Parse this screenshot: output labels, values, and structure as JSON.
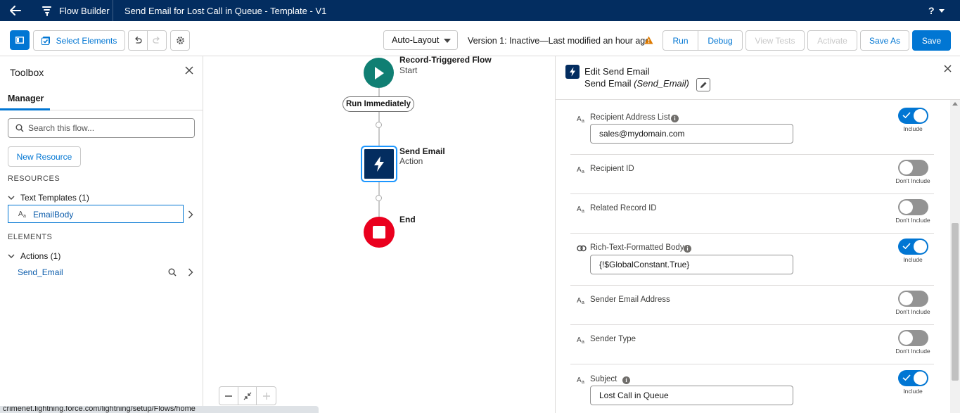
{
  "header": {
    "app_name": "Flow Builder",
    "flow_title": "Send Email for Lost Call in Queue - Template - V1",
    "help_label": "?"
  },
  "toolbar": {
    "select_elements": "Select Elements",
    "layout": "Auto-Layout",
    "version_status": "Version 1: Inactive—Last modified an hour ago",
    "run": "Run",
    "debug": "Debug",
    "view_tests": "View Tests",
    "activate": "Activate",
    "save_as": "Save As",
    "save": "Save"
  },
  "toolbox": {
    "title": "Toolbox",
    "tab": "Manager",
    "search_placeholder": "Search this flow...",
    "new_resource": "New Resource",
    "resources_heading": "RESOURCES",
    "text_templates": "Text Templates (1)",
    "resource_item": "EmailBody",
    "elements_heading": "ELEMENTS",
    "actions": "Actions (1)",
    "element_item": "Send_Email"
  },
  "canvas": {
    "start_title": "Record-Triggered Flow",
    "start_sub": "Start",
    "run_pill": "Run Immediately",
    "action_title": "Send Email",
    "action_sub": "Action",
    "end_title": "End",
    "status_url": "crimenet.lightning.force.com/lightning/setup/Flows/home"
  },
  "panel": {
    "title": "Edit Send Email",
    "sub_name": "Send Email",
    "sub_api": "(Send_Email)",
    "params": [
      {
        "label": "Recipient Address List",
        "info": true,
        "value": "sales@mydomain.com",
        "include": true,
        "toggle_text": "Include"
      },
      {
        "label": "Recipient ID",
        "info": false,
        "value": null,
        "include": false,
        "toggle_text": "Don't Include"
      },
      {
        "label": "Related Record ID",
        "info": false,
        "value": null,
        "include": false,
        "toggle_text": "Don't Include"
      },
      {
        "label": "Rich-Text-Formatted Body",
        "info": true,
        "value": "{!$GlobalConstant.True}",
        "include": true,
        "toggle_text": "Include"
      },
      {
        "label": "Sender Email Address",
        "info": false,
        "value": null,
        "include": false,
        "toggle_text": "Don't Include"
      },
      {
        "label": "Sender Type",
        "info": false,
        "value": null,
        "include": false,
        "toggle_text": "Don't Include"
      },
      {
        "label": "Subject",
        "info": true,
        "value": "Lost Call in Queue",
        "include": true,
        "toggle_text": "Include"
      }
    ]
  },
  "colors": {
    "header_bg": "#032d60",
    "brand": "#0176d3",
    "start_node": "#107f73",
    "end_node": "#ea001e",
    "warning": "#dd7a01"
  }
}
